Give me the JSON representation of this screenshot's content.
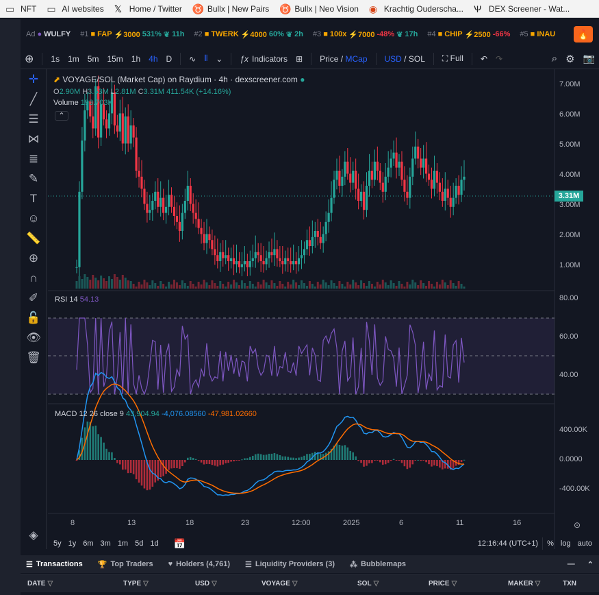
{
  "bookmarks": [
    {
      "label": "NFT",
      "icon": "folder-icon"
    },
    {
      "label": "AI websites",
      "icon": "folder-icon"
    },
    {
      "label": "Home / Twitter",
      "icon": "x-logo-icon"
    },
    {
      "label": "Bullx | New Pairs",
      "icon": "bull-icon"
    },
    {
      "label": "Bullx | Neo Vision",
      "icon": "bull-icon"
    },
    {
      "label": "Krachtig Ouderscha...",
      "icon": "site-icon"
    },
    {
      "label": "DEX Screener - Wat...",
      "icon": "dex-icon"
    }
  ],
  "ticker": {
    "ad_label": "Ad",
    "ad_token": "WULFY",
    "items": [
      {
        "rank": "#1",
        "name": "FAP",
        "score": "⚡3000",
        "change": "531%",
        "dir": "up",
        "age": "11h"
      },
      {
        "rank": "#2",
        "name": "TWERK",
        "score": "⚡4000",
        "change": "60%",
        "dir": "up",
        "age": "2h"
      },
      {
        "rank": "#3",
        "name": "100x",
        "score": "⚡7000",
        "change": "-48%",
        "dir": "down",
        "age": "17h"
      },
      {
        "rank": "#4",
        "name": "CHIP",
        "score": "⚡2500",
        "change": "-66%",
        "dir": "down",
        "age": ""
      },
      {
        "rank": "#5",
        "name": "INAU",
        "score": "",
        "change": "",
        "dir": "",
        "age": ""
      }
    ]
  },
  "toolbar": {
    "intervals": [
      "1s",
      "1m",
      "5m",
      "15m",
      "1h",
      "4h",
      "D"
    ],
    "active_interval": "4h",
    "indicators": "Indicators",
    "price": "Price",
    "mcap": "MCap",
    "usd": "USD",
    "sol": "SOL",
    "full": "Full"
  },
  "legend": {
    "title": "VOYAGE/SOL (Market Cap) on Raydium · 4h · dexscreener.com",
    "o": "2.90M",
    "h": "3.53M",
    "l": "2.81M",
    "c": "3.31M",
    "chg": "411.54K (+14.16%)",
    "vol_label": "Volume",
    "vol_value": "193.703K",
    "rsi_label": "RSI 14",
    "rsi_value": "54.13",
    "macd_label": "MACD 12 26 close 9",
    "macd_hist": "43,904.94",
    "macd_line": "-4,076.08560",
    "macd_signal": "-47,981.02660"
  },
  "price_axis": [
    "7.00M",
    "6.00M",
    "5.00M",
    "4.00M",
    "3.00M",
    "2.00M",
    "1.00M"
  ],
  "last_price": "3.31M",
  "rsi_axis": [
    "80.00",
    "60.00",
    "40.00"
  ],
  "macd_axis": [
    "400.00K",
    "0.0000",
    "-400.00K"
  ],
  "time_axis": [
    "8",
    "13",
    "18",
    "23",
    "12:00",
    "2025",
    "6",
    "11",
    "16"
  ],
  "bottom": {
    "ranges": [
      "5y",
      "1y",
      "6m",
      "3m",
      "1m",
      "5d",
      "1d"
    ],
    "clock": "12:16:44 (UTC+1)",
    "pct": "%",
    "log": "log",
    "auto": "auto"
  },
  "tabs": [
    "Transactions",
    "Top Traders",
    "Holders (4,761)",
    "Liquidity Providers (3)",
    "Bubblemaps"
  ],
  "table_headers": [
    "DATE",
    "TYPE",
    "USD",
    "VOYAGE",
    "SOL",
    "PRICE",
    "MAKER",
    "TXN"
  ],
  "colors": {
    "up": "#26a69a",
    "down": "#f23645",
    "rsi": "#7e57c2",
    "macd": "#2196f3",
    "signal": "#ff6d00"
  },
  "chart_data": {
    "type": "candlestick",
    "title": "VOYAGE/SOL (Market Cap) on Raydium · 4h · dexscreener.com",
    "x_ticks": [
      "8",
      "13",
      "18",
      "23",
      "12:00",
      "2025",
      "6",
      "11",
      "16"
    ],
    "y_range": [
      0,
      7000000
    ],
    "close": [
      0.3,
      2.8,
      4.5,
      5.5,
      5.8,
      5.3,
      4.9,
      6.3,
      4.6,
      5.7,
      5.2,
      4.9,
      5.4,
      6.1,
      5.0,
      4.8,
      5.4,
      4.4,
      5.3,
      4.4,
      5.0,
      4.6,
      3.5,
      3.3,
      2.9,
      2.4,
      2.1,
      2.2,
      2.5,
      2.8,
      2.3,
      2.6,
      2.1,
      2.3,
      2.7,
      2.3,
      2.0,
      1.8,
      1.5,
      2.1,
      2.5,
      3.0,
      2.4,
      2.1,
      1.9,
      1.6,
      1.4,
      1.1,
      1.4,
      1.2,
      0.9,
      0.7,
      0.5,
      0.8,
      0.6,
      0.7,
      0.5,
      0.6,
      0.4,
      0.5,
      0.3,
      0.4,
      0.5,
      0.3,
      0.5,
      0.6,
      0.8,
      0.7,
      0.5,
      0.4,
      0.6,
      0.8,
      0.7,
      0.9,
      0.6,
      0.5,
      0.4,
      0.6,
      0.5,
      0.4,
      0.5,
      0.4,
      0.6,
      0.7,
      0.9,
      1.2,
      1.0,
      1.3,
      1.5,
      1.3,
      1.1,
      1.4,
      1.8,
      2.1,
      2.6,
      3.2,
      3.5,
      3.0,
      3.3,
      3.8,
      3.4,
      3.1,
      3.5,
      2.9,
      2.5,
      2.8,
      2.2,
      3.0,
      3.5,
      3.2,
      3.8,
      3.5,
      3.1,
      2.8,
      3.3,
      3.6,
      3.9,
      4.1,
      3.6,
      3.8,
      3.2,
      2.8,
      2.6,
      3.3,
      3.9,
      4.3,
      3.9,
      3.6,
      3.9,
      3.4,
      3.2,
      2.9,
      3.5,
      3.1,
      2.8,
      2.5,
      2.9,
      2.6,
      2.3,
      2.6,
      3.0,
      2.7,
      3.2,
      3.3
    ],
    "volume_label": "Volume",
    "rsi": {
      "range": [
        30,
        80
      ],
      "levels": [
        70,
        50,
        30
      ]
    },
    "macd": {
      "range": [
        -500000,
        500000
      ]
    }
  }
}
